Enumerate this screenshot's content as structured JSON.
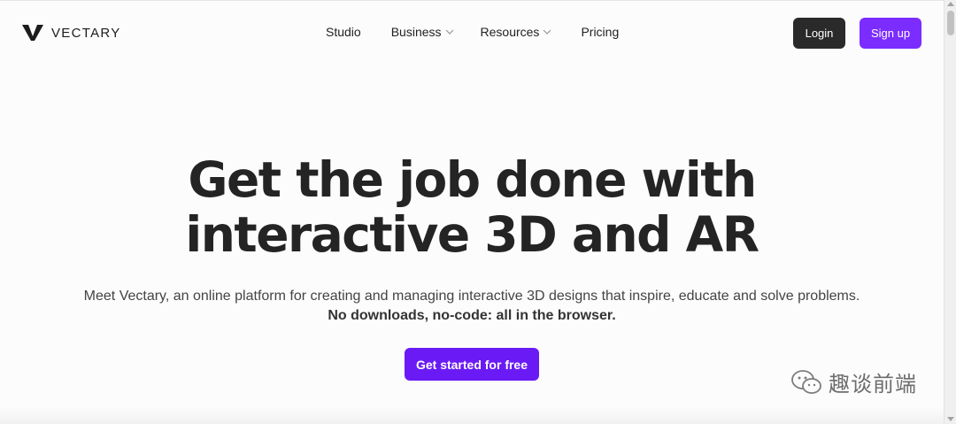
{
  "header": {
    "logo_text": "VECTARY",
    "nav": {
      "studio": "Studio",
      "business": "Business",
      "resources": "Resources",
      "pricing": "Pricing"
    },
    "login_label": "Login",
    "signup_label": "Sign up"
  },
  "hero": {
    "title_line1": "Get the job done with",
    "title_line2": "interactive 3D and AR",
    "subtitle": "Meet Vectary, an online platform for creating and managing interactive 3D designs that inspire, educate and solve problems.",
    "subtitle_strong": "No downloads, no-code: all in the browser.",
    "cta_label": "Get started for free"
  },
  "watermark": {
    "text": "趣谈前端"
  },
  "colors": {
    "brand_purple": "#7b2cff",
    "cta_purple": "#6a1bf5",
    "dark_button": "#2a2a2a",
    "text_dark": "#242424"
  }
}
